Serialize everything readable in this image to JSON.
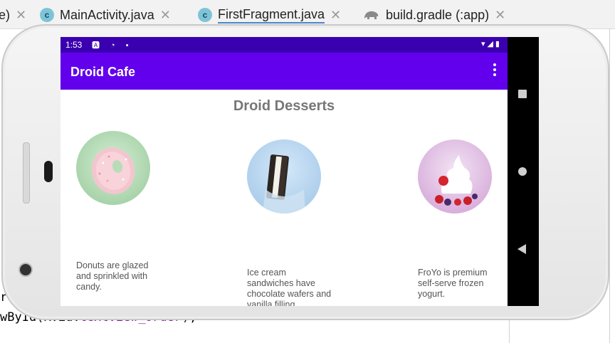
{
  "ide": {
    "tabs": [
      {
        "label": "e)",
        "icon": "",
        "active": false
      },
      {
        "label": "MainActivity.java",
        "icon": "c",
        "active": false
      },
      {
        "label": "FirstFragment.java",
        "icon": "c",
        "active": true
      },
      {
        "label": "build.gradle (:app)",
        "icon": "gradle-elephant-icon",
        "active": false
      }
    ],
    "close_glyph": "✕",
    "code_lines": [
      {
        "text": "r"
      },
      {
        "prefix": "wById(R.id.",
        "keyword": "textview_order",
        "suffix": ");"
      }
    ]
  },
  "phone": {
    "status_bar": {
      "time": "1:53",
      "left_icons": "🅰 ◔ ▪",
      "right_icons": "▾◢▮"
    },
    "app_bar": {
      "title": "Droid Cafe"
    },
    "content": {
      "title": "Droid Desserts",
      "items": [
        {
          "image": "donut-image",
          "description": "Donuts are glazed and sprinkled with candy."
        },
        {
          "image": "ice-cream-sandwich-image",
          "description": "Ice cream sandwiches have chocolate wafers and vanilla filling."
        },
        {
          "image": "froyo-image",
          "description": "FroYo is premium self-serve frozen yogurt."
        }
      ]
    },
    "fab_icon": "shopping-cart-icon",
    "colors": {
      "status_bar": "#3a00b0",
      "app_bar": "#6200ee",
      "fab": "#14d1b8",
      "title_text": "#777777"
    }
  }
}
